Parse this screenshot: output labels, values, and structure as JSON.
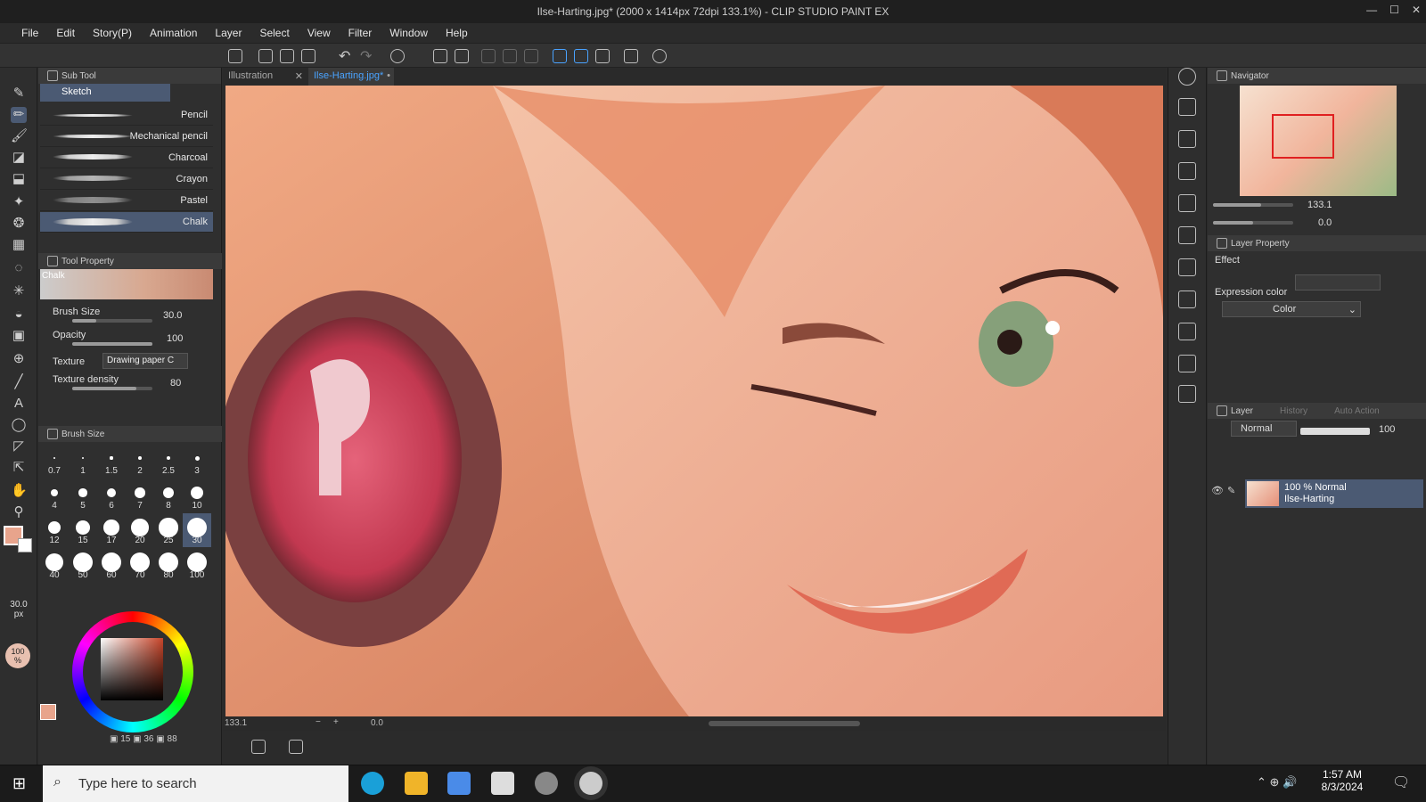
{
  "window": {
    "title": "Ilse-Harting.jpg* (2000 x 1414px 72dpi 133.1%)  - CLIP STUDIO PAINT EX"
  },
  "menu": [
    "File",
    "Edit",
    "Story(P)",
    "Animation",
    "Layer",
    "Select",
    "View",
    "Filter",
    "Window",
    "Help"
  ],
  "subtool": {
    "header": "Sub Tool",
    "group": "Sketch",
    "brushes": [
      "Pencil",
      "Mechanical pencil",
      "Charcoal",
      "Crayon",
      "Pastel",
      "Chalk"
    ],
    "selected": "Chalk"
  },
  "toolproperty": {
    "header": "Tool Property",
    "name": "Chalk",
    "brush_size_label": "Brush Size",
    "brush_size_value": "30.0",
    "opacity_label": "Opacity",
    "opacity_value": "100",
    "texture_label": "Texture",
    "texture_value": "Drawing paper C",
    "density_label": "Texture density",
    "density_value": "80",
    "brush_size_fill": 0.3,
    "opacity_fill": 1.0,
    "density_fill": 0.8
  },
  "brushsize_palette": {
    "header": "Brush Size",
    "sizes": [
      "0.7",
      "1",
      "1.5",
      "2",
      "2.5",
      "3",
      "4",
      "5",
      "6",
      "7",
      "8",
      "10",
      "12",
      "15",
      "17",
      "20",
      "25",
      "30",
      "40",
      "50",
      "60",
      "70",
      "80",
      "100"
    ],
    "selected": "30"
  },
  "toolcol": {
    "size_readout": "30.0",
    "size_unit": "px",
    "opacity_readout": "100",
    "opacity_unit": "%"
  },
  "color": {
    "main": "#e8a48c",
    "sub": "#ffffff",
    "bottom_values": [
      "15",
      "36",
      "88"
    ]
  },
  "tabs": [
    "Illustration",
    "Ilse-Harting.jpg*"
  ],
  "status": {
    "zoom": "133.1",
    "angle": "0.0"
  },
  "navigator": {
    "header": "Navigator",
    "zoom": "133.1",
    "angle": "0.0"
  },
  "layerprop": {
    "header": "Layer Property",
    "effect_label": "Effect",
    "expression_label": "Expression color",
    "expression_value": "Color"
  },
  "layers": {
    "tabs": [
      "Layer",
      "History",
      "Auto Action"
    ],
    "blend": "Normal",
    "opacity": "100",
    "items": [
      {
        "line1": "100 % Normal",
        "line2": "Ilse-Harting"
      }
    ]
  },
  "taskbar": {
    "search_placeholder": "Type here to search",
    "time": "1:57 AM",
    "date": "8/3/2024"
  },
  "accent": "#4aa3ff"
}
